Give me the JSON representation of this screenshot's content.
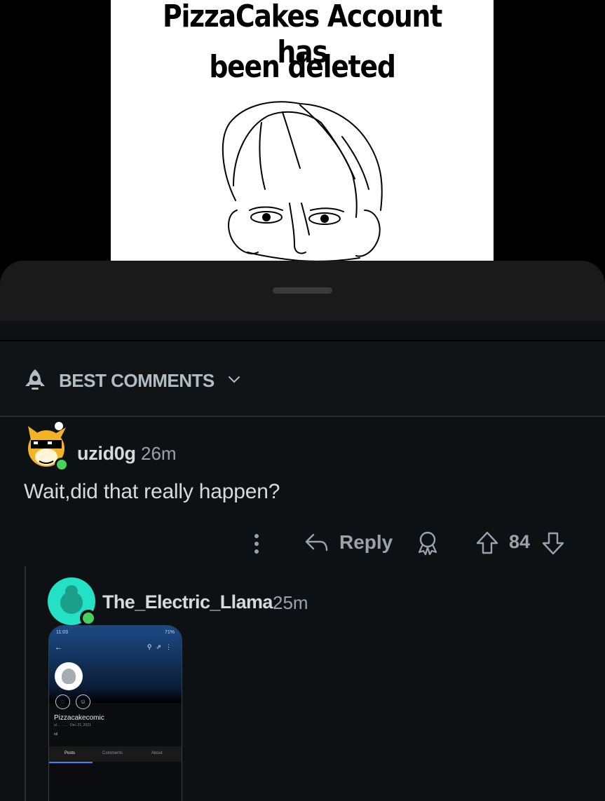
{
  "post_image": {
    "title_line1": "PizzaCakes Account has",
    "title_line2": "been deleted"
  },
  "sort": {
    "icon": "rocket-icon",
    "label": "BEST COMMENTS"
  },
  "comment": {
    "username": "uzid0g",
    "time": "26m",
    "text": "Wait,did that really happen?",
    "actions": {
      "reply_label": "Reply",
      "score": "84"
    }
  },
  "reply": {
    "username": "The_Electric_Llama",
    "time": "25m",
    "screenshot": {
      "status_time": "11:03",
      "status_right": "71%",
      "profile_name": "Pizzacakecomic",
      "meta": "u/… · … · Dec 21, 2021",
      "meta2": "nil",
      "tabs": [
        "Posts",
        "Comments",
        "About"
      ]
    }
  },
  "colors": {
    "background": "#0e1113",
    "text_primary": "#d7dadc",
    "text_secondary": "#9aa3a9",
    "online_indicator": "#46d160",
    "avatar_teal": "#24e0c5"
  }
}
